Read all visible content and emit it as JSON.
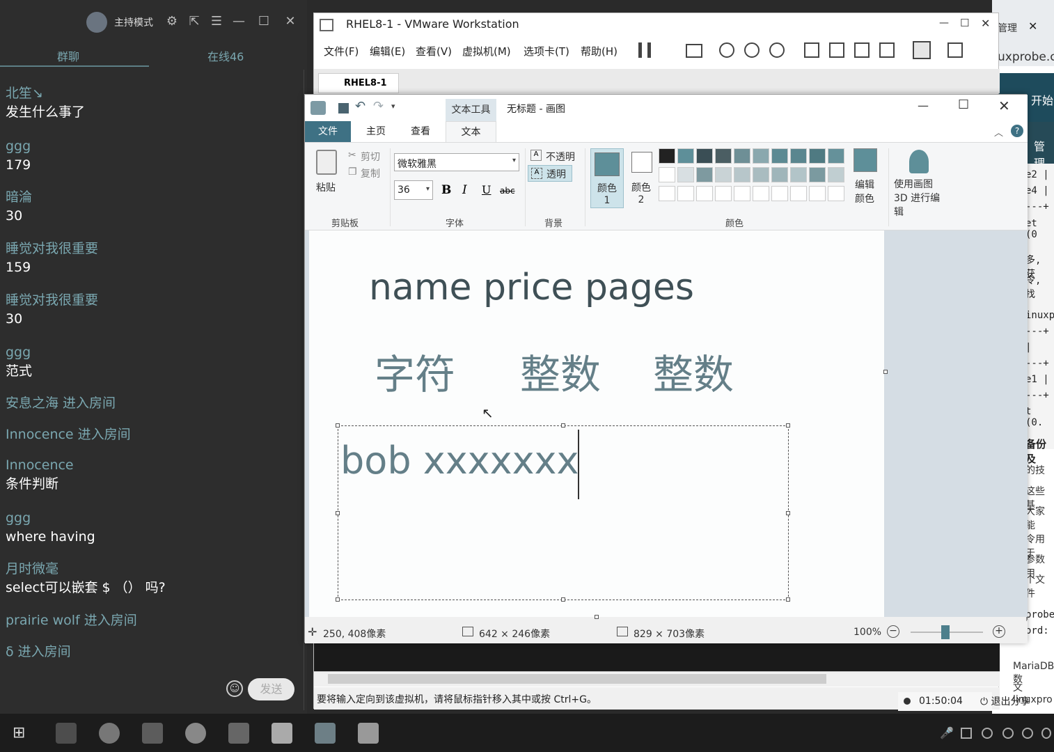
{
  "chat": {
    "mode_label": "主持模式",
    "tab_group": "群聊",
    "tab_online": "在线46",
    "messages": [
      {
        "name": "北笙↘",
        "text": "发生什么事了"
      },
      {
        "name": "ggg",
        "text": "179"
      },
      {
        "name": "暗淪",
        "text": "30"
      },
      {
        "name": "睡觉对我很重要",
        "text": "159"
      },
      {
        "name": "睡觉对我很重要",
        "text": "30"
      },
      {
        "name": "ggg",
        "text": "范式"
      },
      {
        "name": "安息之海 进入房间",
        "text": ""
      },
      {
        "name": "Innocence 进入房间",
        "text": ""
      },
      {
        "name": "Innocence",
        "text": "条件判断"
      },
      {
        "name": "ggg",
        "text": "where  having"
      },
      {
        "name": "月时微毫",
        "text": "select可以嵌套 $ （） 吗?"
      },
      {
        "name": "prairie wolf 进入房间",
        "text": ""
      },
      {
        "name": "δ 进入房间",
        "text": ""
      }
    ],
    "send_label": "发送"
  },
  "right_bg": {
    "top_label": "管理",
    "start_label": "开始",
    "manage_label": "管理",
    "url": "uxprobe.c",
    "lines": [
      "e2 |",
      "e4 |",
      "---+",
      "et (0",
      "多, 获",
      "令, 找",
      "inuxpr",
      "---+",
      "   |",
      "---+",
      "e1 |",
      "---+",
      "t (0.",
      "备份及",
      "的技",
      "这些基",
      "大家能",
      "令用于",
      "参数用",
      "个文件",
      "probe",
      "ord:",
      "MariaDB数",
      "文linuxpro"
    ]
  },
  "vmware": {
    "title": "RHEL8-1 - VMware Workstation",
    "menu": [
      "文件(F)",
      "编辑(E)",
      "查看(V)",
      "虚拟机(M)",
      "选项卡(T)",
      "帮助(H)"
    ],
    "tab_label": "RHEL8-1",
    "status_text": "要将输入定向到该虚拟机，请将鼠标指针移入其中或按 Ctrl+G。",
    "timer": "01:50:04",
    "exit_share": "退出分享"
  },
  "paint": {
    "context_tab": "文本工具",
    "title": "无标题 - 画图",
    "tabs": [
      "文件",
      "主页",
      "查看",
      "文本"
    ],
    "clipboard": {
      "paste": "粘贴",
      "cut": "剪切",
      "copy": "复制",
      "group": "剪贴板"
    },
    "font": {
      "name": "微软雅黑",
      "size": "36",
      "group": "字体",
      "bold": "B",
      "italic": "I",
      "underline": "U",
      "strike": "abc"
    },
    "background": {
      "opaque": "不透明",
      "transparent": "透明",
      "group": "背景"
    },
    "color1": "颜色 1",
    "color2": "颜色 2",
    "colors_group": "颜色",
    "edit_colors": "编辑颜色",
    "paint3d": "使用画图 3D 进行编辑",
    "color1_value": "#5e8f99",
    "palette": [
      "#222222",
      "#5e8f99",
      "#3a4e55",
      "#4b5e63",
      "#6e8f96",
      "#8aa8ae",
      "#5c8a93",
      "#5a868f",
      "#4f7a82",
      "#65919a",
      "#ffffff",
      "#d8dfe2",
      "#7e9aa0",
      "#c9d3d6",
      "#b7c6ca",
      "#a9bcc0",
      "#9fb5ba",
      "#b2c4c8",
      "#7b9aa0",
      "#c0ced1"
    ],
    "canvas": {
      "line1": "name  price pages",
      "line2a": "字符",
      "line2b": "整数",
      "line2c": "整数",
      "textbox": "bob xxxxxxx"
    },
    "status": {
      "cursor": "250, 408像素",
      "selection": "642 × 246像素",
      "size": "829 × 703像素",
      "zoom": "100%"
    }
  }
}
